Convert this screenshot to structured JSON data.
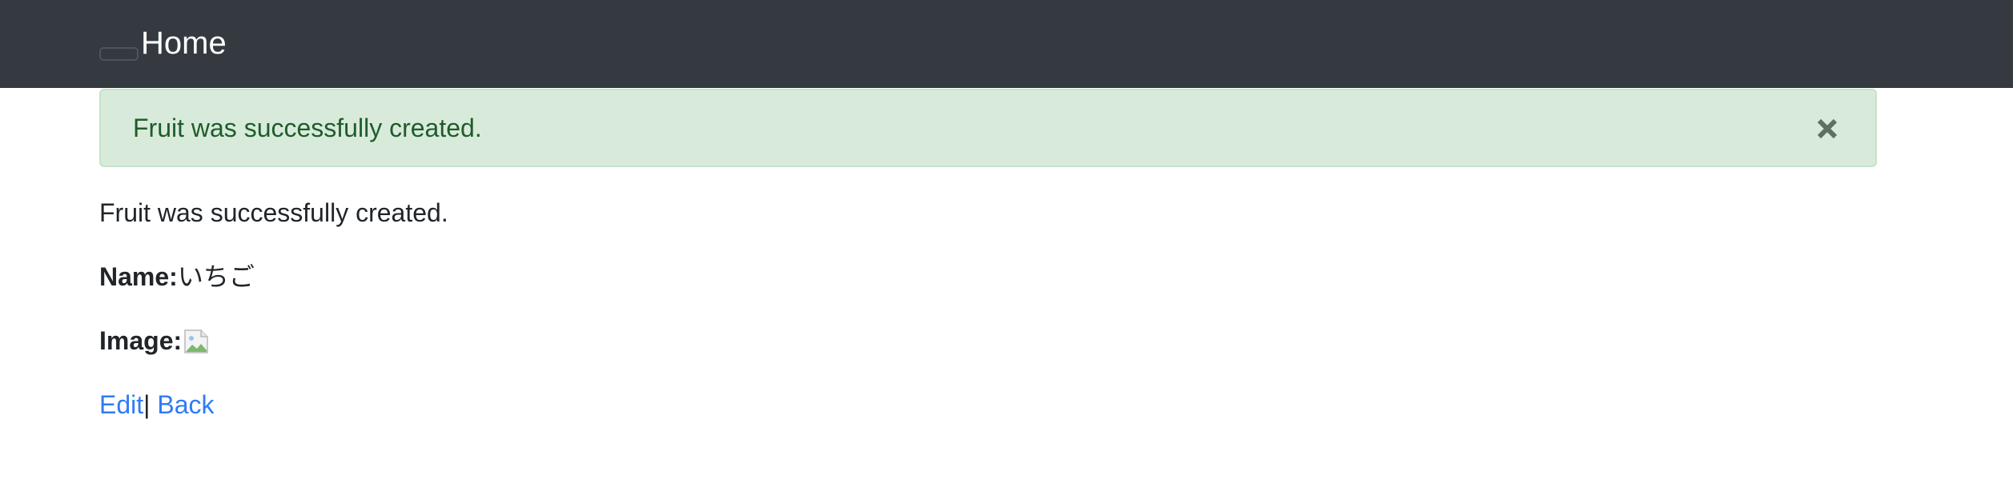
{
  "navbar": {
    "brand": "Home"
  },
  "alert": {
    "message": "Fruit was successfully created."
  },
  "notice": "Fruit was successfully created.",
  "fields": {
    "name_label": "Name:",
    "name_value": "いちご",
    "image_label": "Image:"
  },
  "links": {
    "edit": "Edit",
    "separator": "|",
    "back": "Back"
  },
  "colors": {
    "navbar_bg": "#343a40",
    "alert_bg": "#d8ebdb",
    "alert_text": "#1f5c2b",
    "link": "#2f7bf5"
  },
  "icons": {
    "close": "close-icon",
    "image": "broken-image-icon"
  }
}
